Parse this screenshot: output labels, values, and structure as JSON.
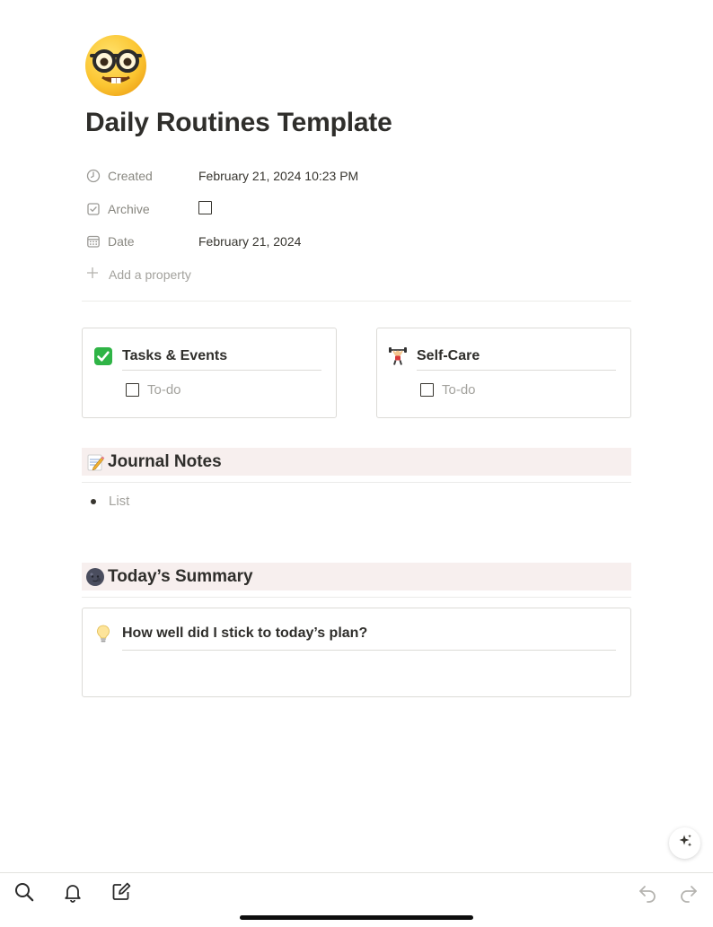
{
  "page": {
    "icon": "nerd-face-icon",
    "title": "Daily Routines Template"
  },
  "properties": [
    {
      "icon": "clock-icon",
      "key": "Created",
      "value": "February 21, 2024 10:23 PM",
      "type": "text"
    },
    {
      "icon": "checkbox-icon",
      "key": "Archive",
      "value": false,
      "type": "checkbox"
    },
    {
      "icon": "calendar-icon",
      "key": "Date",
      "value": "February 21, 2024",
      "type": "text"
    }
  ],
  "add_property": {
    "icon": "plus-icon",
    "label": "Add a property"
  },
  "cards": {
    "tasks": {
      "emoji": "check-mark-button-icon",
      "title": "Tasks & Events",
      "todo": "To-do",
      "checked": false
    },
    "selfcare": {
      "emoji": "person-lifting-weights-icon",
      "title": "Self-Care",
      "todo": "To-do",
      "checked": false
    }
  },
  "journal": {
    "emoji": "memo-icon",
    "heading": "Journal Notes",
    "bullet": "List"
  },
  "summary": {
    "emoji": "new-moon-face-icon",
    "heading": "Today’s Summary",
    "callout_emoji": "light-bulb-icon",
    "callout_title": "How well did I stick to today’s plan?"
  },
  "fab": {
    "icon": "sparkles-icon"
  },
  "toolbar": {
    "left": [
      "search-icon",
      "bell-icon",
      "compose-icon"
    ],
    "right": [
      "undo-icon",
      "redo-icon"
    ]
  },
  "colors": {
    "heading_band": "#f7efee",
    "text": "#37352f",
    "muted": "#888780",
    "placeholder": "#a3a29d",
    "border": "#dcdbd7"
  }
}
